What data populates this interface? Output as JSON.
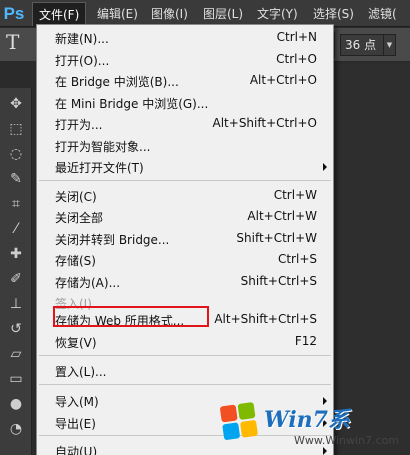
{
  "app": {
    "logo": "Ps"
  },
  "menubar": {
    "items": [
      "文件(F)",
      "编辑(E)",
      "图像(I)",
      "图层(L)",
      "文字(Y)",
      "选择(S)",
      "滤镜("
    ],
    "active_index": 0
  },
  "options_bar": {
    "tool_glyph": "T",
    "font_size": "36 点"
  },
  "file_menu": {
    "items": [
      {
        "label": "新建(N)...",
        "shortcut": "Ctrl+N"
      },
      {
        "label": "打开(O)...",
        "shortcut": "Ctrl+O"
      },
      {
        "label": "在 Bridge 中浏览(B)...",
        "shortcut": "Alt+Ctrl+O"
      },
      {
        "label": "在 Mini Bridge 中浏览(G)...",
        "shortcut": ""
      },
      {
        "label": "打开为...",
        "shortcut": "Alt+Shift+Ctrl+O"
      },
      {
        "label": "打开为智能对象...",
        "shortcut": ""
      },
      {
        "label": "最近打开文件(T)",
        "shortcut": "",
        "submenu": true
      },
      {
        "label": "关闭(C)",
        "shortcut": "Ctrl+W"
      },
      {
        "label": "关闭全部",
        "shortcut": "Alt+Ctrl+W"
      },
      {
        "label": "关闭并转到 Bridge...",
        "shortcut": "Shift+Ctrl+W"
      },
      {
        "label": "存储(S)",
        "shortcut": "Ctrl+S"
      },
      {
        "label": "存储为(A)...",
        "shortcut": "Shift+Ctrl+S"
      },
      {
        "label": "签入(I)...",
        "shortcut": "",
        "disabled": true
      },
      {
        "label": "存储为 Web 所用格式...",
        "shortcut": "Alt+Shift+Ctrl+S",
        "highlighted": true
      },
      {
        "label": "恢复(V)",
        "shortcut": "F12"
      },
      {
        "label": "置入(L)...",
        "shortcut": ""
      },
      {
        "label": "导入(M)",
        "shortcut": "",
        "submenu": true
      },
      {
        "label": "导出(E)",
        "shortcut": "",
        "submenu": true
      },
      {
        "label": "自动(U)",
        "shortcut": "",
        "submenu": true
      }
    ]
  },
  "toolbar": {
    "tools": [
      "move-icon",
      "marquee-icon",
      "lasso-icon",
      "quick-select-icon",
      "crop-icon",
      "eyedropper-icon",
      "healing-brush-icon",
      "brush-icon",
      "clone-stamp-icon",
      "history-brush-icon",
      "eraser-icon",
      "gradient-icon",
      "blur-icon",
      "dodge-icon"
    ]
  },
  "watermark": {
    "logo": "Win7系",
    "url": "Www.Winwin7.com",
    "colors": [
      "#f25022",
      "#7fba00",
      "#00a4ef",
      "#ffb900"
    ]
  },
  "colors": {
    "menu_bg": "#f0f0f0",
    "highlight_border": "#e1141c",
    "ps_blue": "#4fb8ff"
  }
}
